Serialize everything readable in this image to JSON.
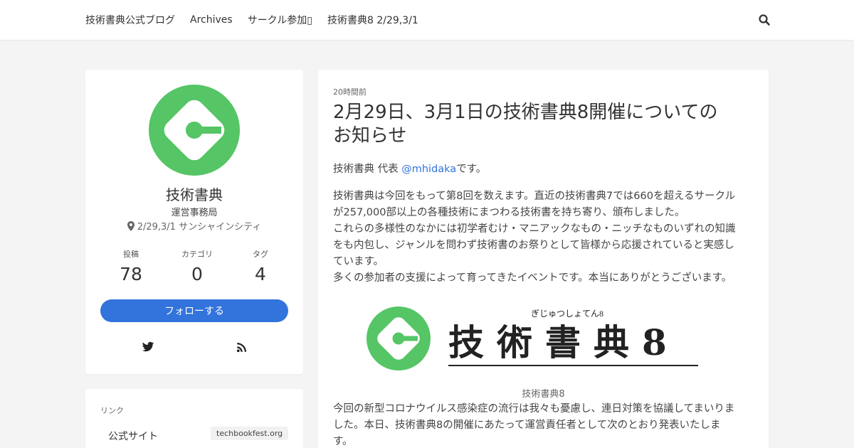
{
  "nav": {
    "items": [
      "技術書典公式ブログ",
      "Archives",
      "サークル参加▯",
      "技術書典8 2/29,3/1"
    ]
  },
  "profile": {
    "name": "技術書典",
    "org": "運営事務局",
    "location": "2/29,3/1 サンシャインシティ",
    "stats": [
      {
        "label": "投稿",
        "value": "78"
      },
      {
        "label": "カテゴリ",
        "value": "0"
      },
      {
        "label": "タグ",
        "value": "4"
      }
    ],
    "follow_label": "フォローする",
    "brand_color": "#55c566",
    "accent_color": "#3273dc"
  },
  "links": {
    "title": "リンク",
    "items": [
      {
        "name": "公式サイト",
        "tag": "techbookfest.org"
      }
    ]
  },
  "article": {
    "date": "20時間前",
    "title_line1": "2月29日、3月1日の技術書典8開催についての",
    "title_line2": "お知らせ",
    "intro_prefix": "技術書典 代表 ",
    "intro_mention": "@mhidaka",
    "intro_suffix": "です。",
    "body_lines": [
      "技術書典は今回をもって第8回を数えます。直近の技術書典7では660を超えるサークル",
      "が257,000部以上の各種技術にまつわる技術書を持ち寄り、頒布しました。",
      "これらの多様性のなかには初学者むけ・マニアックなもの・ニッチなものいずれの知識",
      "をも内包し、ジャンルを問わず技術書のお祭りとして皆様から応援されていると実感し",
      "ています。",
      "多くの参加者の支援によって育ってきたイベントです。本当にありがとうございます。"
    ],
    "hero_ruby": "ぎじゅつしょてん8",
    "hero_text": "技術書典8",
    "caption": "技術書典8",
    "news_lines": [
      "今回の新型コロナウイルス感染症の流行は我々も憂慮し、連日対策を協議してまいりま",
      "した。本日、技術書典8の開催にあたって運営責任者として次のとおり発表いたしま",
      "す。"
    ]
  }
}
